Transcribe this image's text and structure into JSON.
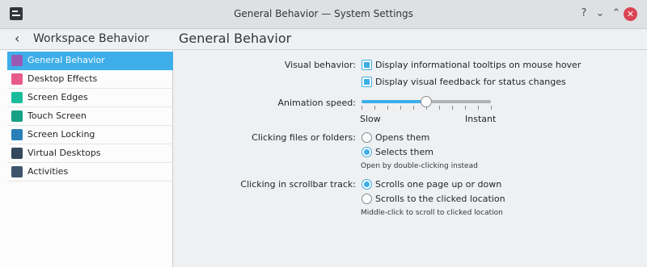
{
  "window": {
    "title": "General Behavior — System Settings",
    "help_glyph": "?",
    "min_glyph": "⌄",
    "max_glyph": "⌃",
    "close_glyph": "✕"
  },
  "sidebar": {
    "back_glyph": "‹",
    "title": "Workspace Behavior",
    "items": [
      {
        "label": "General Behavior",
        "icon": "general-behavior-icon",
        "color": "#9b59b6",
        "active": true
      },
      {
        "label": "Desktop Effects",
        "icon": "desktop-effects-icon",
        "color": "#e85a8a"
      },
      {
        "label": "Screen Edges",
        "icon": "screen-edges-icon",
        "color": "#1abc9c"
      },
      {
        "label": "Touch Screen",
        "icon": "touch-screen-icon",
        "color": "#16a085"
      },
      {
        "label": "Screen Locking",
        "icon": "screen-locking-icon",
        "color": "#2980b9"
      },
      {
        "label": "Virtual Desktops",
        "icon": "virtual-desktops-icon",
        "color": "#34495e"
      },
      {
        "label": "Activities",
        "icon": "activities-icon",
        "color": "#3d566e"
      }
    ]
  },
  "main": {
    "title": "General Behavior",
    "visual_behavior": {
      "label": "Visual behavior:",
      "tooltips_label": "Display informational tooltips on mouse hover",
      "tooltips_checked": true,
      "feedback_label": "Display visual feedback for status changes",
      "feedback_checked": true
    },
    "animation_speed": {
      "label": "Animation speed:",
      "min_label": "Slow",
      "max_label": "Instant",
      "value_fraction": 0.5,
      "ticks": 11
    },
    "clicking_files": {
      "label": "Clicking files or folders:",
      "options": [
        "Opens them",
        "Selects them"
      ],
      "selected": 1,
      "hint": "Open by double-clicking instead"
    },
    "scrollbar_track": {
      "label": "Clicking in scrollbar track:",
      "options": [
        "Scrolls one page up or down",
        "Scrolls to the clicked location"
      ],
      "selected": 0,
      "hint": "Middle-click to scroll to clicked location"
    }
  },
  "colors": {
    "accent": "#3daee9",
    "close": "#da4453"
  }
}
